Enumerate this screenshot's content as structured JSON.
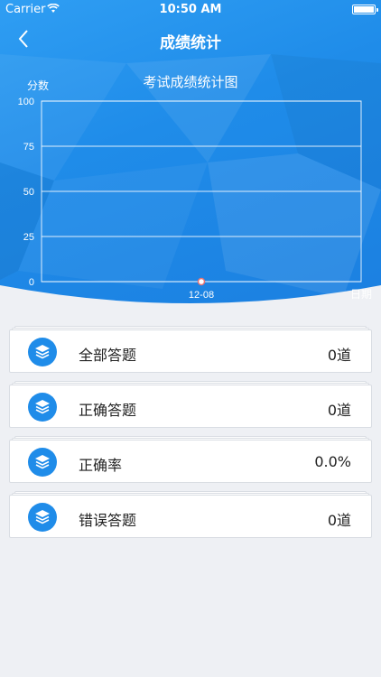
{
  "status_bar": {
    "carrier": "Carrier",
    "time": "10:50 AM"
  },
  "nav": {
    "title": "成绩统计",
    "back_icon": "chevron-left-icon"
  },
  "colors": {
    "primary": "#1f8ce9",
    "background": "#eef0f4",
    "card": "#ffffff"
  },
  "chart_data": {
    "type": "line",
    "title": "考试成绩统计图",
    "ylabel": "分数",
    "xlabel": "日期",
    "ylim": [
      0,
      100
    ],
    "yticks": [
      0,
      25,
      50,
      75,
      100
    ],
    "categories": [
      "12-08"
    ],
    "series": [
      {
        "values": [
          0
        ]
      }
    ],
    "grid": true
  },
  "stats": [
    {
      "label": "全部答题",
      "value": "0道",
      "icon": "layers-icon"
    },
    {
      "label": "正确答题",
      "value": "0道",
      "icon": "layers-icon"
    },
    {
      "label": "正确率",
      "value": "0.0%",
      "icon": "layers-icon"
    },
    {
      "label": "错误答题",
      "value": "0道",
      "icon": "layers-icon"
    }
  ]
}
